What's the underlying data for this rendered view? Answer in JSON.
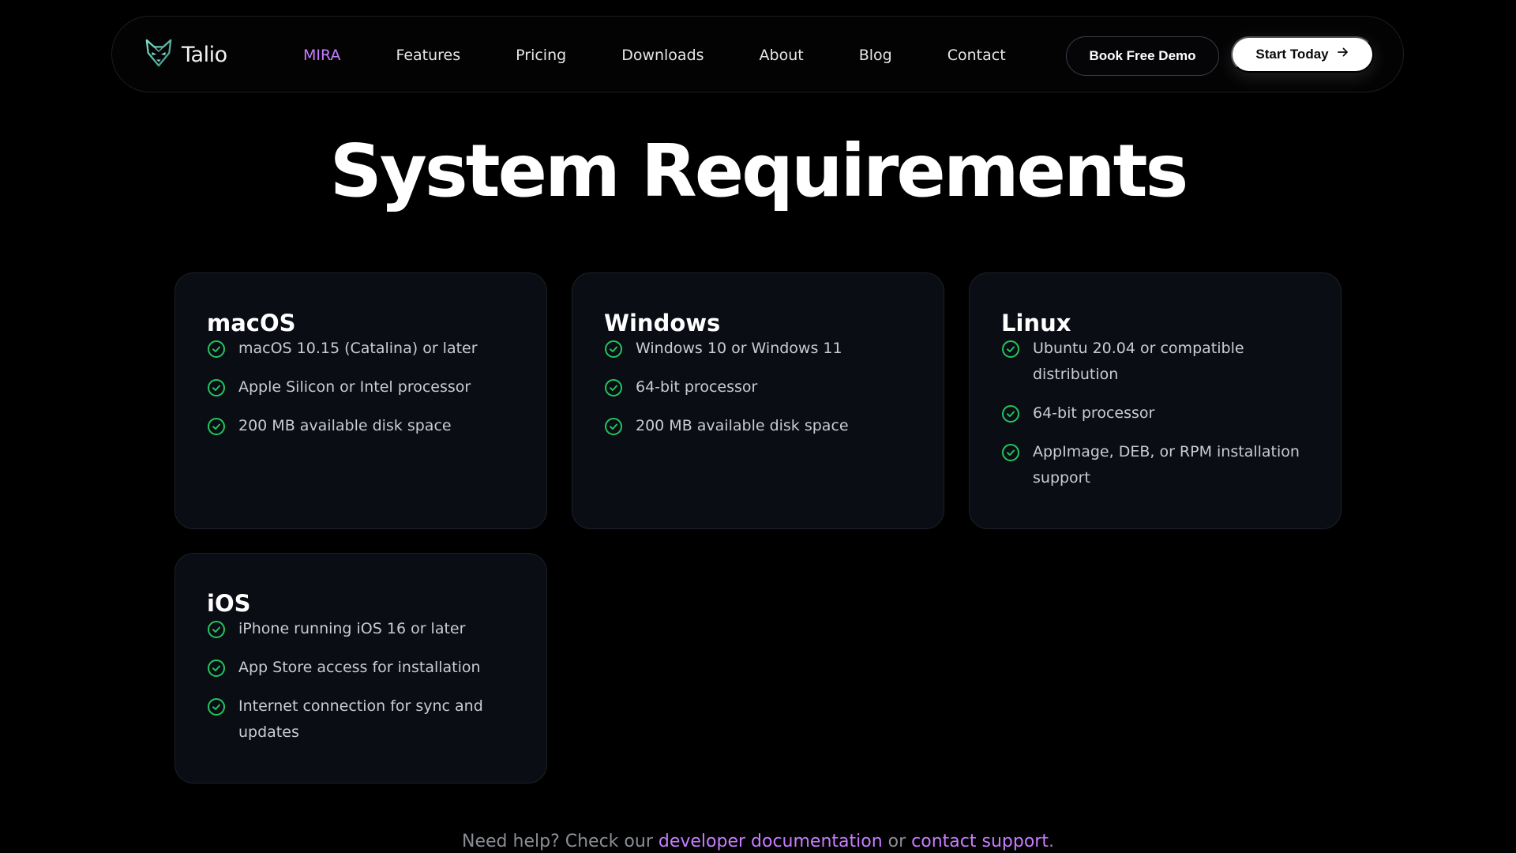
{
  "colors": {
    "background": "#000000",
    "accent": "#c77dff",
    "check_green": "#22c55e",
    "card_bg": "#0a0d14"
  },
  "header": {
    "logo_icon": "fox-logo-icon",
    "logo_text": "Talio",
    "nav": [
      "MIRA",
      "Features",
      "Pricing",
      "Downloads",
      "About",
      "Blog",
      "Contact"
    ],
    "active_nav": "MIRA",
    "book_demo_label": "Book Free Demo",
    "start_today_label": "Start Today",
    "start_today_icon": "arrow-right-icon"
  },
  "main": {
    "title": "System Requirements",
    "check_icon": "check-circle-icon",
    "platforms": [
      {
        "name": "macOS",
        "requirements": [
          "macOS 10.15 (Catalina) or later",
          "Apple Silicon or Intel processor",
          "200 MB available disk space"
        ]
      },
      {
        "name": "Windows",
        "requirements": [
          "Windows 10 or Windows 11",
          "64-bit processor",
          "200 MB available disk space"
        ]
      },
      {
        "name": "Linux",
        "requirements": [
          "Ubuntu 20.04 or compatible distribution",
          "64-bit processor",
          "AppImage, DEB, or RPM installation support"
        ]
      },
      {
        "name": "iOS",
        "requirements": [
          "iPhone running iOS 16 or later",
          "App Store access for installation",
          "Internet connection for sync and updates"
        ]
      }
    ]
  },
  "footer": {
    "help_prefix": "Need help? Check our ",
    "docs_link": "developer documentation",
    "middle": " or ",
    "support_link": "contact support",
    "suffix": "."
  }
}
